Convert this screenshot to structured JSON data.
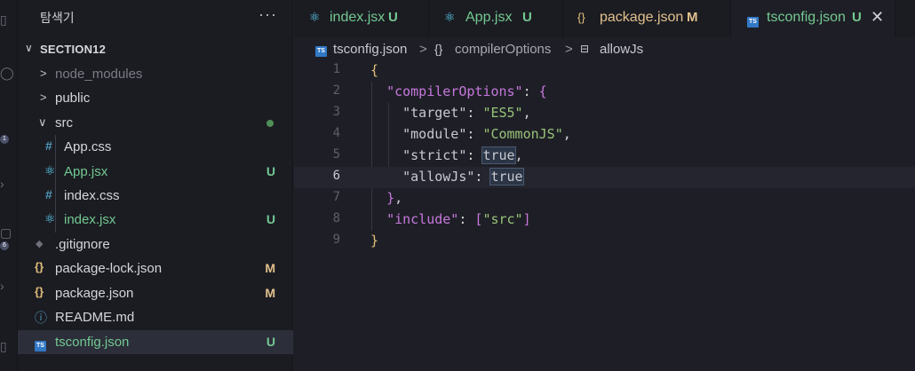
{
  "sidebar": {
    "title": "탐색기",
    "more": "···",
    "section": "SECTION12",
    "items": [
      {
        "label": "node_modules",
        "arrow": ">",
        "color": "#7a7c87"
      },
      {
        "label": "public",
        "arrow": ">"
      },
      {
        "label": "src",
        "arrow": "∨",
        "status": "dot"
      },
      {
        "label": "App.css",
        "icon": "#",
        "iconColor": "#519aba"
      },
      {
        "label": "App.jsx",
        "icon": "⚛",
        "iconColor": "#61dafb",
        "status": "U",
        "color": "#73c991"
      },
      {
        "label": "index.css",
        "icon": "#",
        "iconColor": "#519aba"
      },
      {
        "label": "index.jsx",
        "icon": "⚛",
        "iconColor": "#61dafb",
        "status": "U",
        "color": "#73c991"
      },
      {
        "label": ".gitignore",
        "icon": "◆",
        "iconColor": "#6d6f7a"
      },
      {
        "label": "package-lock.json",
        "icon": "{}",
        "iconColor": "#e5c07b",
        "status": "M",
        "color": "#e2c08d"
      },
      {
        "label": "package.json",
        "icon": "{}",
        "iconColor": "#e5c07b",
        "status": "M",
        "color": "#e2c08d"
      },
      {
        "label": "README.md",
        "icon": "ⓘ",
        "iconColor": "#519aba"
      },
      {
        "label": "tsconfig.json",
        "icon": "TS",
        "status": "U",
        "color": "#73c991"
      }
    ]
  },
  "tabs": [
    {
      "name": "index.jsx",
      "status": "U",
      "color": "#73c991"
    },
    {
      "name": "App.jsx",
      "status": "U",
      "color": "#73c991"
    },
    {
      "name": "package.json",
      "status": "M",
      "color": "#e2c08d"
    },
    {
      "name": "tsconfig.json",
      "status": "U",
      "close": "✕",
      "color": "#73c991"
    }
  ],
  "breadcrumb": {
    "file": "tsconfig.json",
    "sep": ">",
    "obj_icon": "{}",
    "obj": "compilerOptions",
    "prop": "allowJs"
  },
  "editor": {
    "line_numbers": [
      "1",
      "2",
      "3",
      "4",
      "5",
      "6",
      "7",
      "8",
      "9"
    ],
    "current_line": 6,
    "lines": {
      "l1_open": "{",
      "l2_key": "\"compilerOptions\"",
      "l2_colon": ": ",
      "l2_brace": "{",
      "l3_key": "\"target\"",
      "l3_colon": ": ",
      "l3_val": "\"ES5\"",
      "l3_comma": ",",
      "l4_key": "\"module\"",
      "l4_colon": ": ",
      "l4_val": "\"CommonJS\"",
      "l4_comma": ",",
      "l5_key": "\"strict\"",
      "l5_colon": ": ",
      "l5_val": "true",
      "l5_comma": ",",
      "l6_key": "\"allowJs\"",
      "l6_colon": ": ",
      "l6_val": "true",
      "l7_brace": "}",
      "l7_comma": ",",
      "l8_key": "\"include\"",
      "l8_colon": ": ",
      "l8_open": "[",
      "l8_val": "\"src\"",
      "l8_close": "]",
      "l9_close": "}"
    }
  },
  "activity": {
    "badge1": "1",
    "badge2": "6"
  }
}
